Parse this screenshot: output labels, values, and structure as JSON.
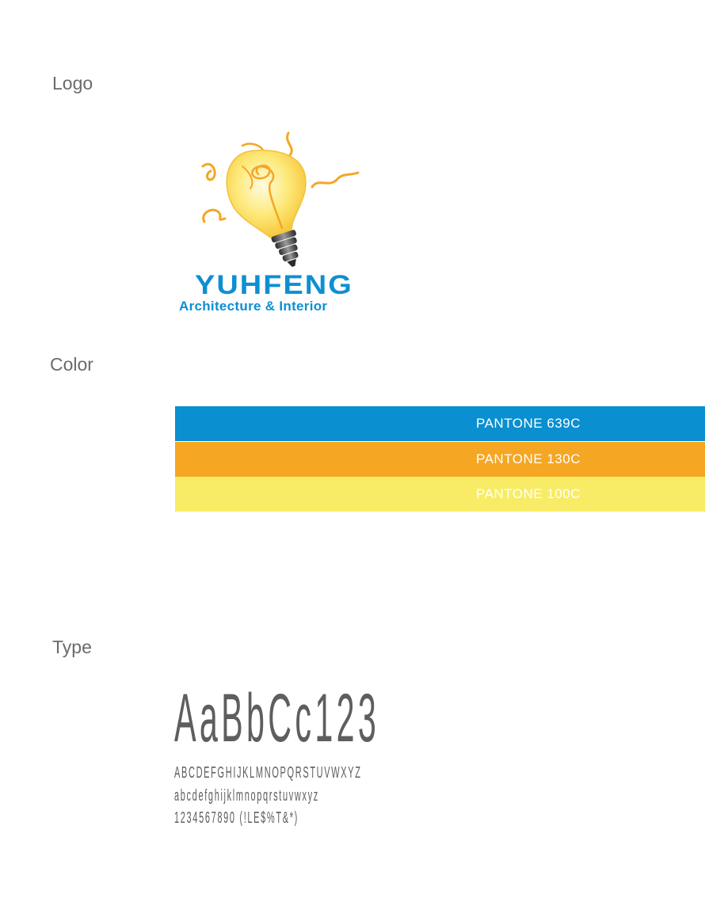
{
  "sections": {
    "logo": "Logo",
    "color": "Color",
    "type": "Type"
  },
  "logo": {
    "brand_name": "YUHFENG",
    "tagline": "Architecture & Interior",
    "bulb_icon": "light-bulb-icon"
  },
  "colors": {
    "swatches": [
      {
        "label": "PANTONE 639C",
        "hex": "#0a8fd0"
      },
      {
        "label": "PANTONE 130C",
        "hex": "#f5a623"
      },
      {
        "label": "PANTONE 100C",
        "hex": "#f8ec66"
      }
    ]
  },
  "type": {
    "specimen": "AaBbCc123",
    "uppercase": "ABCDEFGHIJKLMNOPQRSTUVWXYZ",
    "lowercase": "abcdefghijklmnopqrstuvwxyz",
    "numerals": "1234567890 (!LE$%T&*)"
  }
}
